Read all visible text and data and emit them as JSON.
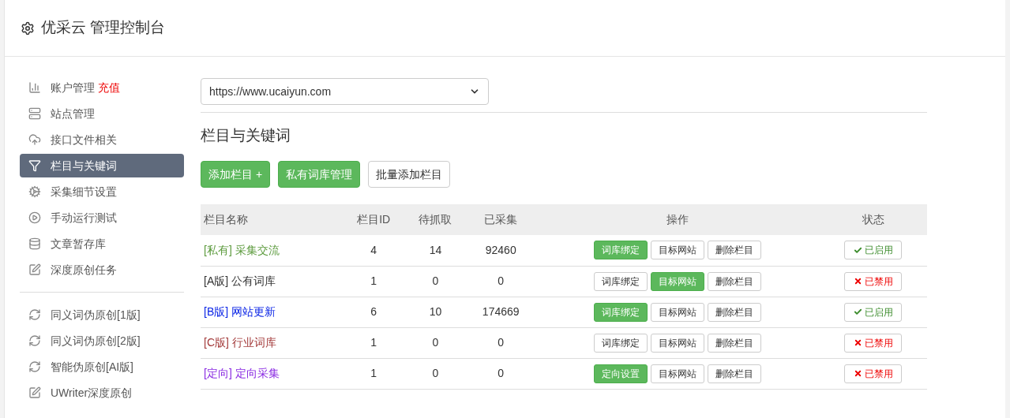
{
  "header": {
    "title": "优采云 管理控制台"
  },
  "sidebar": {
    "groups": [
      [
        {
          "label": "账户管理",
          "badge": "充值",
          "kind": "chart",
          "selected": false
        },
        {
          "label": "站点管理",
          "kind": "server",
          "selected": false
        },
        {
          "label": "接口文件相关",
          "kind": "cloud",
          "selected": false
        },
        {
          "label": "栏目与关键词",
          "kind": "filter",
          "selected": true
        },
        {
          "label": "采集细节设置",
          "kind": "cogs",
          "selected": false
        },
        {
          "label": "手动运行测试",
          "kind": "play",
          "selected": false
        },
        {
          "label": "文章暂存库",
          "kind": "database",
          "selected": false
        },
        {
          "label": "深度原创任务",
          "kind": "edit",
          "selected": false
        }
      ],
      [
        {
          "label": "同义词伪原创[1版]",
          "kind": "refresh",
          "selected": false
        },
        {
          "label": "同义词伪原创[2版]",
          "kind": "refresh",
          "selected": false
        },
        {
          "label": "智能伪原创[AI版]",
          "kind": "refresh",
          "selected": false
        },
        {
          "label": "UWriter深度原创",
          "kind": "edit",
          "selected": false
        }
      ]
    ]
  },
  "site_select": {
    "value": "https://www.ucaiyun.com"
  },
  "section_title": "栏目与关键词",
  "toolbar": [
    {
      "label": "添加栏目 +",
      "primary": true
    },
    {
      "label": "私有词库管理",
      "primary": true
    },
    {
      "label": "批量添加栏目",
      "primary": false
    }
  ],
  "table": {
    "columns": [
      "栏目名称",
      "栏目ID",
      "待抓取",
      "已采集",
      "操作",
      "状态"
    ],
    "rows": [
      {
        "tag": "[私有]",
        "name": "采集交流",
        "color": "#5b9a3c",
        "id": "4",
        "pending": "14",
        "collected": "92460",
        "actions": [
          {
            "label": "词库绑定",
            "primary": true
          },
          {
            "label": "目标网站",
            "primary": false
          },
          {
            "label": "删除栏目",
            "primary": false
          }
        ],
        "status": "已启用",
        "enabled": true
      },
      {
        "tag": "[A版]",
        "name": "公有词库",
        "color": "#333333",
        "id": "1",
        "pending": "0",
        "collected": "0",
        "actions": [
          {
            "label": "词库绑定",
            "primary": false
          },
          {
            "label": "目标网站",
            "primary": true
          },
          {
            "label": "删除栏目",
            "primary": false
          }
        ],
        "status": "已禁用",
        "enabled": false
      },
      {
        "tag": "[B版]",
        "name": "网站更新",
        "color": "#0a24e6",
        "id": "6",
        "pending": "10",
        "collected": "174669",
        "actions": [
          {
            "label": "词库绑定",
            "primary": true
          },
          {
            "label": "目标网站",
            "primary": false
          },
          {
            "label": "删除栏目",
            "primary": false
          }
        ],
        "status": "已启用",
        "enabled": true
      },
      {
        "tag": "[C版]",
        "name": "行业词库",
        "color": "#a33a3a",
        "id": "1",
        "pending": "0",
        "collected": "0",
        "actions": [
          {
            "label": "词库绑定",
            "primary": false
          },
          {
            "label": "目标网站",
            "primary": false
          },
          {
            "label": "删除栏目",
            "primary": false
          }
        ],
        "status": "已禁用",
        "enabled": false
      },
      {
        "tag": "[定向]",
        "name": "定向采集",
        "color": "#8a2be2",
        "id": "1",
        "pending": "0",
        "collected": "0",
        "actions": [
          {
            "label": "定向设置",
            "primary": true
          },
          {
            "label": "目标网站",
            "primary": false
          },
          {
            "label": "删除栏目",
            "primary": false
          }
        ],
        "status": "已禁用",
        "enabled": false
      }
    ]
  }
}
